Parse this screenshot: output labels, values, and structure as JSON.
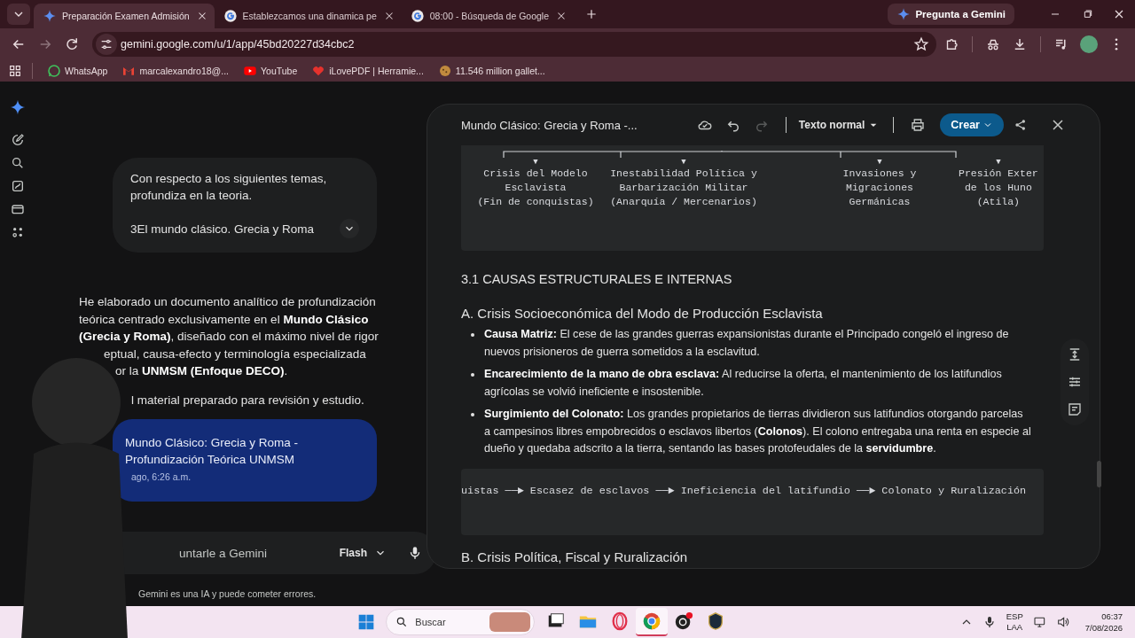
{
  "browser": {
    "tabs": [
      {
        "title": "Preparación Examen Admisión",
        "selected": true
      },
      {
        "title": "Establezcamos una dinamica pe",
        "selected": false
      },
      {
        "title": "08:00 - Búsqueda de Google",
        "selected": false
      }
    ],
    "ask_button": "Pregunta a Gemini",
    "url": "gemini.google.com/u/1/app/45bd20227d34cbc2",
    "bookmarks": [
      "WhatsApp",
      "marcalexandro18@...",
      "YouTube",
      "iLovePDF | Herramie...",
      "11.546 million gallet..."
    ]
  },
  "chat": {
    "user_message": {
      "text": "Con respecto a los siguientes temas, profundiza en la teoria.",
      "attachment": "3El mundo clásico. Grecia y Roma"
    },
    "response_lines": [
      {
        "kind": "full",
        "text": "He elaborado un documento analítico de profundización teórica centrado exclusivamente en el **Mundo Clásico (Grecia y Roma)**, diseñado con el máximo nivel de rigor"
      },
      {
        "kind": "cut",
        "text": "eptual, causa-efecto y terminología especializada"
      },
      {
        "kind": "cut",
        "text": "or la **UNMSM (Enfoque DECO)**."
      },
      {
        "kind": "cut",
        "text": "l material preparado para revisión y estudio."
      }
    ],
    "doc_card": {
      "title": "Mundo Clásico: Grecia y Roma - Profundización Teórica UNMSM",
      "date": "ago, 6:26 a.m."
    },
    "input": {
      "placeholder": "untarle a Gemini",
      "model": "Flash"
    },
    "disclaimer": "Gemini es una IA y puede cometer errores."
  },
  "document": {
    "title": "Mundo Clásico: Grecia y Roma -...",
    "style_select": "Texto normal",
    "create_button": "Crear",
    "diagram_columns": [
      {
        "marker": "▼",
        "lines": [
          "Crisis del Modelo",
          "Esclavista",
          "(Fin de conquistas)"
        ]
      },
      {
        "marker": "▼",
        "lines": [
          "Inestabilidad Política y",
          "Barbarización Militar",
          "(Anarquía / Mercenarios)"
        ]
      },
      {
        "marker": "▼",
        "lines": [
          "Invasiones y",
          "Migraciones",
          "Germánicas"
        ]
      },
      {
        "marker": "▼",
        "lines": [
          "Presión Exter",
          "de los Huno",
          "(Atila)"
        ]
      }
    ],
    "section_heading": "3.1 CAUSAS ESTRUCTURALES E INTERNAS",
    "subheading": "A. Crisis Socioeconómica del Modo de Producción Esclavista",
    "bullets": [
      "**Causa Matriz:** El cese de las grandes guerras expansionistas durante el Principado congeló el ingreso de nuevos prisioneros de guerra sometidos a la esclavitud.",
      "**Encarecimiento de la mano de obra esclava:** Al reducirse la oferta, el mantenimiento de los latifundios agrícolas se volvió ineficiente e insostenible.",
      "**Surgimiento del Colonato:** Los grandes propietarios de tierras dividieron sus latifundios otorgando parcelas a campesinos libres empobrecidos o esclavos libertos (**Colonos**). El colono entregaba una renta en especie al dueño y quedaba adscrito a la tierra, sentando las bases protofeudales de la **servidumbre**."
    ],
    "flow": "uistas ──► Escasez de esclavos ──► Ineficiencia del latifundio ──► Colonato y Ruralización",
    "next_heading": "B. Crisis Política, Fiscal y Ruralización"
  },
  "taskbar": {
    "search_placeholder": "Buscar",
    "apps": [
      {
        "active": false
      },
      {
        "active": false
      },
      {
        "active": false
      },
      {
        "active": true
      },
      {
        "active": false
      },
      {
        "active": false
      }
    ],
    "language": "ESP",
    "layout": "LAA",
    "time": "06:37",
    "date": "7/08/2026"
  }
}
